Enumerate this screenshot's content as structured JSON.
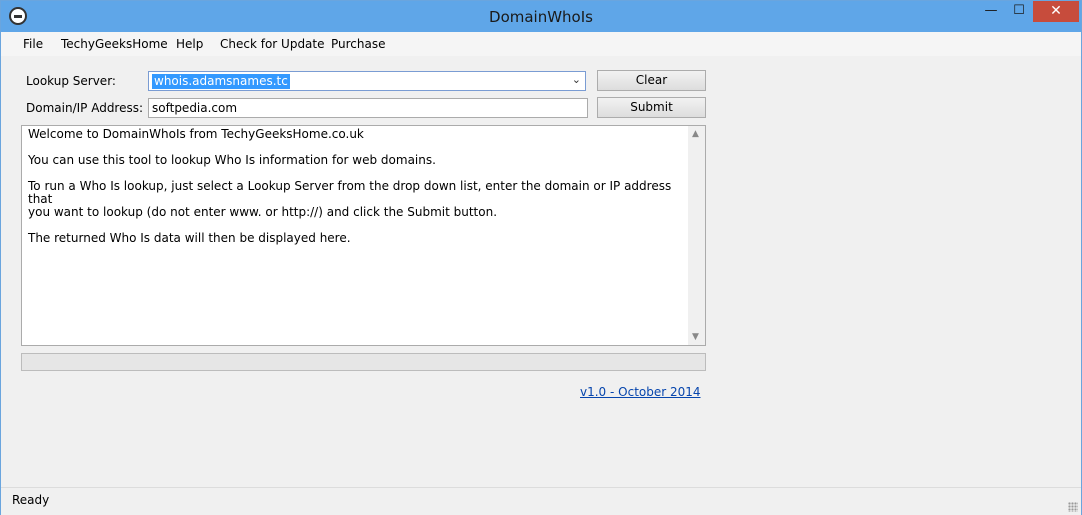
{
  "window": {
    "title": "DomainWhoIs",
    "minimize": "—",
    "maximize": "☐",
    "close": "✕"
  },
  "menu": [
    "File",
    "TechyGeeksHome",
    "Help",
    "Check for Update",
    "Purchase"
  ],
  "form": {
    "lookup_label": "Lookup Server:",
    "lookup_value": "whois.adamsnames.tc",
    "domain_label": "Domain/IP Address:",
    "domain_value": "softpedia.com",
    "clear_label": "Clear",
    "submit_label": "Submit"
  },
  "output": {
    "text": "Welcome to DomainWhoIs from TechyGeeksHome.co.uk\n\nYou can use this tool to lookup Who Is information for web domains.\n\nTo run a Who Is lookup, just select a Lookup Server from the drop down list, enter the domain or IP address that\nyou want to lookup (do not enter www. or http://) and click the Submit button.\n\nThe returned Who Is data will then be displayed here."
  },
  "progress": {
    "value": 0
  },
  "version_link": "v1.0 - October 2014",
  "status": {
    "text": "Ready"
  },
  "icons": {
    "app": "tgh-logo-icon",
    "dropdown": "chevron-down-icon",
    "scroll_up": "arrow-up-icon",
    "scroll_down": "arrow-down-icon",
    "grip": "resize-grip-icon"
  },
  "colors": {
    "titlebar": "#5fa6e8",
    "close": "#c74c3c",
    "selection": "#3399ff",
    "link": "#0645ad"
  }
}
